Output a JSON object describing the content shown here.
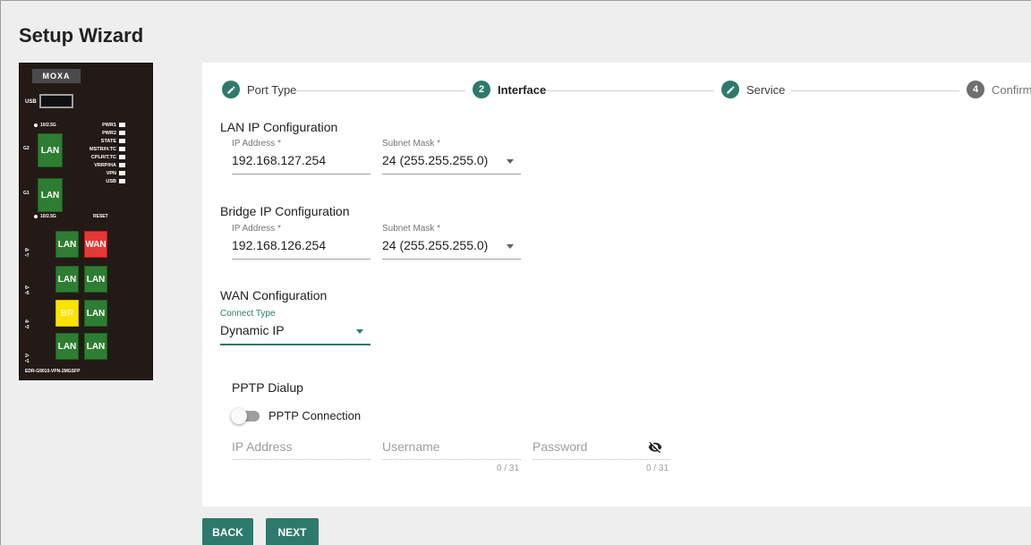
{
  "page": {
    "title": "Setup Wizard"
  },
  "device": {
    "brand": "MOXA",
    "usb_label": "USB",
    "leds": [
      "PWR1",
      "PWR2",
      "STATE",
      "MSTR/H.TC",
      "CPLR/T.TC",
      "VRRP/HA",
      "VPN",
      "USB"
    ],
    "speed_label_top": "10/2.5G",
    "speed_label_bottom": "10/2.5G",
    "reset_label": "RESET",
    "g2_label": "G2",
    "g1_label": "G1",
    "ports": {
      "g2": "LAN",
      "g1": "LAN",
      "p8": "LAN",
      "p7": "WAN",
      "p6": "LAN",
      "p5": "LAN",
      "p4": "BR",
      "p3": "LAN",
      "p2": "LAN",
      "p1": "LAN"
    },
    "side_labels": {
      "a": "8•\n•7",
      "b": "6•\n•5",
      "c": "4•\n•3",
      "d": "2•\n•1"
    },
    "model": "EDR-G9010-VPN-2MGSFP"
  },
  "stepper": {
    "steps": [
      {
        "label": "Port Type",
        "state": "done",
        "badge": "edit-icon"
      },
      {
        "label": "Interface",
        "state": "active",
        "number": "2"
      },
      {
        "label": "Service",
        "state": "done",
        "badge": "edit-icon"
      },
      {
        "label": "Confirm",
        "state": "pending",
        "number": "4"
      }
    ]
  },
  "lan": {
    "title": "LAN IP Configuration",
    "ip_label": "IP Address *",
    "ip_value": "192.168.127.254",
    "mask_label": "Subnet Mask *",
    "mask_value": "24 (255.255.255.0)"
  },
  "bridge": {
    "title": "Bridge IP Configuration",
    "ip_label": "IP Address *",
    "ip_value": "192.168.126.254",
    "mask_label": "Subnet Mask *",
    "mask_value": "24 (255.255.255.0)"
  },
  "wan": {
    "title": "WAN Configuration",
    "connect_type_label": "Connect Type",
    "connect_type_value": "Dynamic IP"
  },
  "pptp": {
    "title": "PPTP Dialup",
    "toggle_label": "PPTP Connection",
    "toggle_on": false,
    "ip_placeholder": "IP Address",
    "username_placeholder": "Username",
    "username_counter": "0 / 31",
    "password_placeholder": "Password",
    "password_counter": "0 / 31"
  },
  "actions": {
    "back": "BACK",
    "next": "NEXT"
  },
  "colors": {
    "accent": "#2d7a6c",
    "background": "#eeeeee"
  }
}
